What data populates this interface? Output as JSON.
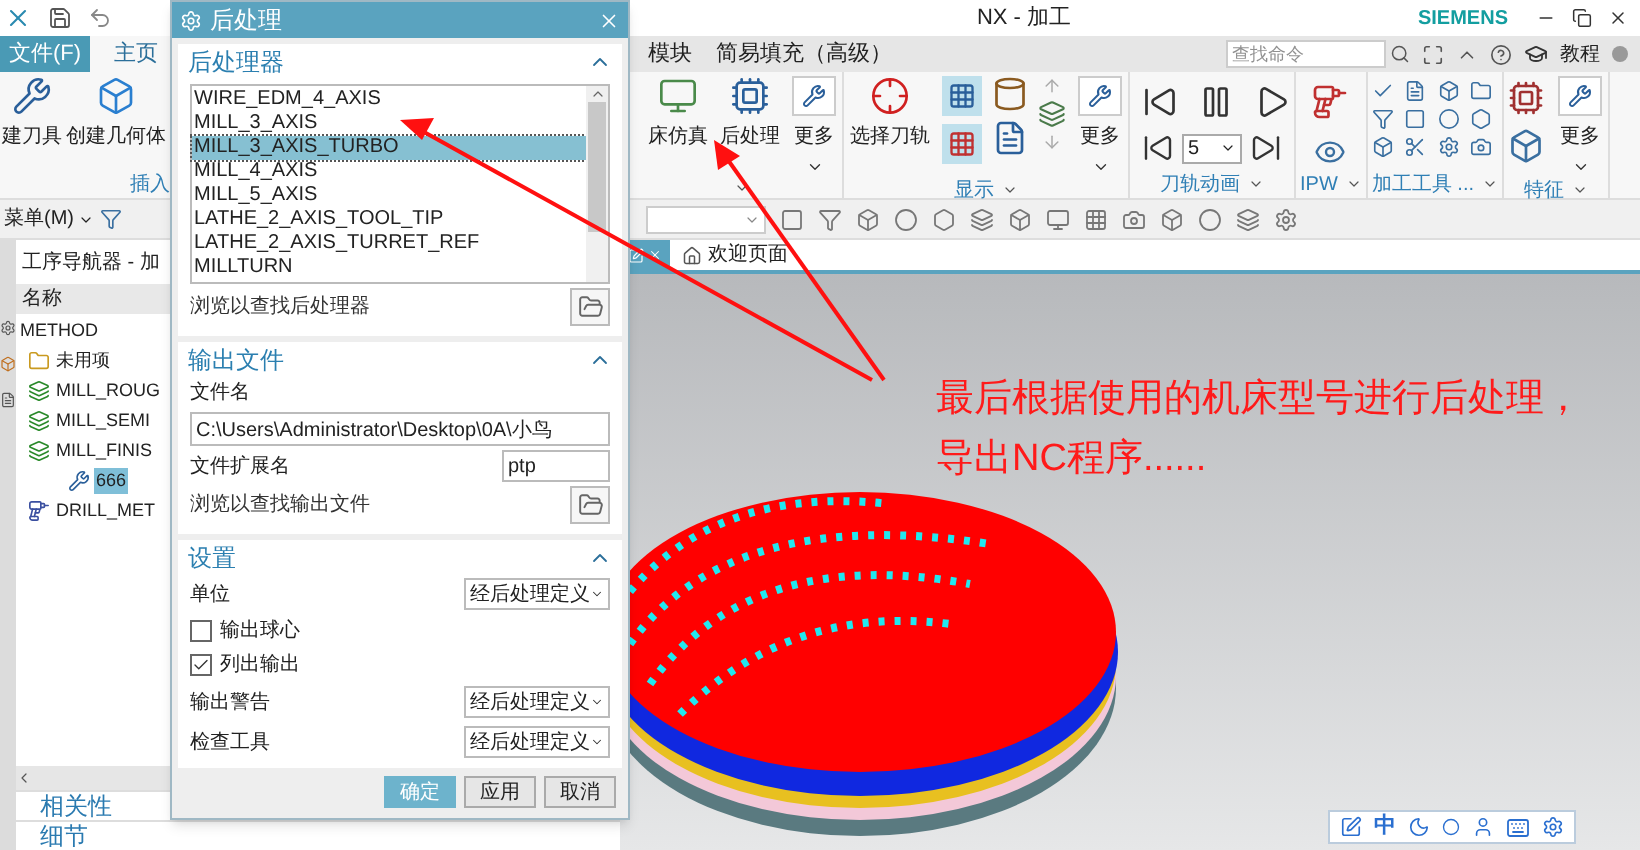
{
  "app": {
    "title": "NX - 加工",
    "brand": "SIEMENS"
  },
  "menu_tabs": [
    {
      "label": "文件(F)",
      "kind": "file",
      "selected": false
    },
    {
      "label": "主页",
      "kind": "tab",
      "selected": true
    },
    {
      "label": "模块",
      "kind": "tab",
      "selected": false
    },
    {
      "label": "简易填充（高级）",
      "kind": "tab",
      "selected": false
    }
  ],
  "search": {
    "placeholder": "查找命令"
  },
  "help_link": "教程",
  "ribbon": {
    "left": {
      "buttons": [
        "建刀具",
        "创建几何体"
      ],
      "group": "插入"
    },
    "groups": [
      {
        "kind": "actions",
        "buttons": [
          "床仿真",
          "后处理",
          "更多"
        ]
      },
      {
        "kind": "display",
        "label": "显示",
        "buttons": [
          "选择刀轨",
          "更多"
        ]
      },
      {
        "kind": "animation",
        "label": "刀轨动画",
        "speed": "5"
      },
      {
        "kind": "icons",
        "label": "IPW"
      },
      {
        "kind": "tools",
        "label": "加工工具 ..."
      },
      {
        "kind": "feature",
        "label": "特征",
        "buttons": [
          "更多"
        ]
      }
    ]
  },
  "menu_button": "菜单(M)",
  "nav": {
    "title": "工序导航器 - 加",
    "column": "名称",
    "tree": [
      {
        "label": "METHOD",
        "kind": "root",
        "selected": false,
        "children": [
          {
            "label": "未用项",
            "kind": "folder",
            "selected": false
          },
          {
            "label": "MILL_ROUG",
            "kind": "method",
            "selected": false
          },
          {
            "label": "MILL_SEMI",
            "kind": "method",
            "selected": false
          },
          {
            "label": "MILL_FINIS",
            "kind": "method",
            "selected": false,
            "children": [
              {
                "label": "666",
                "kind": "operation",
                "selected": true
              }
            ]
          },
          {
            "label": "DRILL_MET",
            "kind": "drill",
            "selected": false
          }
        ]
      }
    ],
    "panels": [
      "相关性",
      "细节"
    ]
  },
  "viewport": {
    "tab": "欢迎页面",
    "annotation": "最后根据使用的机床型号进行后处理，导出NC程序......",
    "ime_label": "中"
  },
  "dialog": {
    "title": "后处理",
    "processor": {
      "title": "后处理器",
      "items": [
        {
          "label": "WIRE_EDM_4_AXIS",
          "selected": false
        },
        {
          "label": "MILL_3_AXIS",
          "selected": false
        },
        {
          "label": "MILL_3_AXIS_TURBO",
          "selected": true
        },
        {
          "label": "MILL_4_AXIS",
          "selected": false
        },
        {
          "label": "MILL_5_AXIS",
          "selected": false
        },
        {
          "label": "LATHE_2_AXIS_TOOL_TIP",
          "selected": false
        },
        {
          "label": "LATHE_2_AXIS_TURRET_REF",
          "selected": false
        },
        {
          "label": "MILLTURN",
          "selected": false
        }
      ],
      "browse": "浏览以查找后处理器"
    },
    "output": {
      "title": "输出文件",
      "filename_label": "文件名",
      "filename": "C:\\Users\\Administrator\\Desktop\\0A\\小鸟",
      "ext_label": "文件扩展名",
      "ext": "ptp",
      "browse": "浏览以查找输出文件"
    },
    "settings": {
      "title": "设置",
      "rows": [
        {
          "kind": "select",
          "label": "单位",
          "value": "经后处理定义"
        },
        {
          "kind": "checkbox",
          "label": "输出球心",
          "checked": false
        },
        {
          "kind": "checkbox",
          "label": "列出输出",
          "checked": true
        },
        {
          "kind": "select",
          "label": "输出警告",
          "value": "经后处理定义"
        },
        {
          "kind": "select",
          "label": "检查工具",
          "value": "经后处理定义"
        }
      ]
    },
    "buttons": [
      {
        "label": "确定",
        "kind": "primary"
      },
      {
        "label": "应用",
        "kind": "normal"
      },
      {
        "label": "取消",
        "kind": "normal"
      }
    ]
  }
}
